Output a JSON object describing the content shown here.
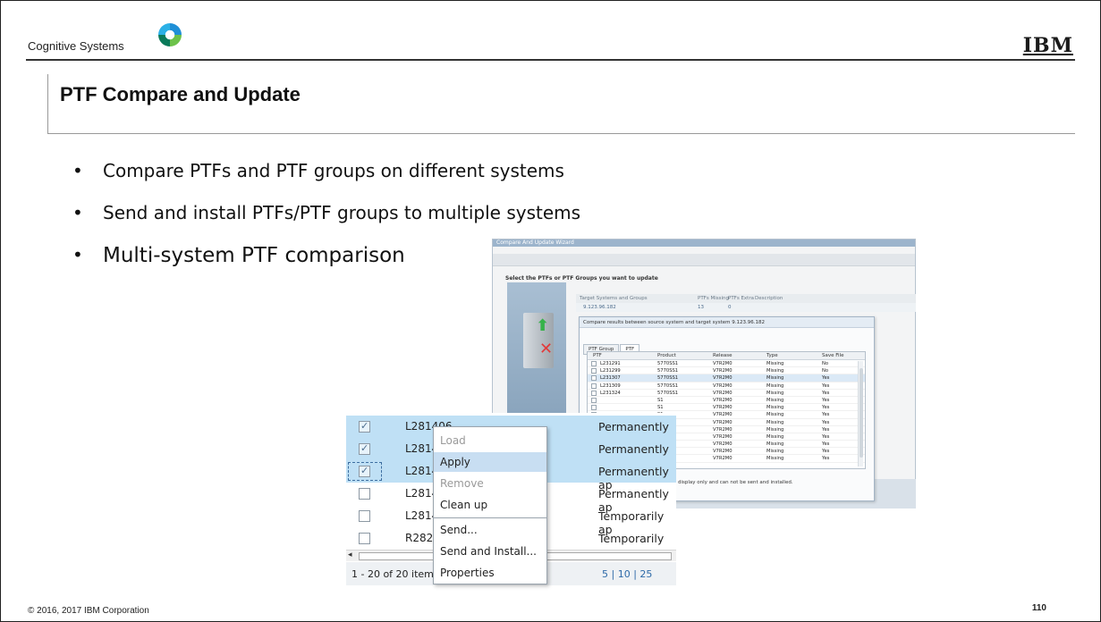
{
  "header": {
    "brand_text": "Cognitive Systems",
    "logo_text": "IBM"
  },
  "slide": {
    "title": "PTF Compare and Update",
    "bullets": [
      "Compare PTFs and PTF groups on different systems",
      "Send and install PTFs/PTF groups to multiple systems",
      "Multi-system PTF comparison"
    ]
  },
  "wizard": {
    "window_title": "Compare And Update Wizard",
    "heading": "Select the PTFs or PTF Groups you want to update",
    "target_columns": [
      "Target Systems and Groups",
      "PTFs Missing",
      "PTFs Extra",
      "Description"
    ],
    "target_row": {
      "system": "9.123.96.182",
      "missing": "13",
      "extra": "0"
    }
  },
  "compare_dialog": {
    "title": "Compare results between source system and target system 9.123.96.182",
    "tabs": [
      "PTF Group",
      "PTF"
    ],
    "columns": [
      "PTF",
      "Product",
      "Release",
      "Type",
      "Save File"
    ],
    "rows": [
      {
        "ptf": "L231291",
        "product": "5770SS1",
        "release": "V7R2M0",
        "type": "Missing",
        "save": "No"
      },
      {
        "ptf": "L231299",
        "product": "5770SS1",
        "release": "V7R2M0",
        "type": "Missing",
        "save": "No"
      },
      {
        "ptf": "L231307",
        "product": "5770SS1",
        "release": "V7R2M0",
        "type": "Missing",
        "save": "Yes"
      },
      {
        "ptf": "L231309",
        "product": "5770SS1",
        "release": "V7R2M0",
        "type": "Missing",
        "save": "Yes"
      },
      {
        "ptf": "L231324",
        "product": "5770SS1",
        "release": "V7R2M0",
        "type": "Missing",
        "save": "Yes"
      },
      {
        "ptf": "",
        "product": "S1",
        "release": "V7R2M0",
        "type": "Missing",
        "save": "Yes"
      },
      {
        "ptf": "",
        "product": "S1",
        "release": "V7R2M0",
        "type": "Missing",
        "save": "Yes"
      },
      {
        "ptf": "",
        "product": "S1",
        "release": "V7R2M0",
        "type": "Missing",
        "save": "Yes"
      },
      {
        "ptf": "",
        "product": "S1",
        "release": "V7R2M0",
        "type": "Missing",
        "save": "Yes"
      },
      {
        "ptf": "",
        "product": "S1",
        "release": "V7R2M0",
        "type": "Missing",
        "save": "Yes"
      },
      {
        "ptf": "",
        "product": "S1",
        "release": "V7R2M0",
        "type": "Missing",
        "save": "Yes"
      },
      {
        "ptf": "",
        "product": "S1",
        "release": "V7R2M0",
        "type": "Missing",
        "save": "Yes"
      },
      {
        "ptf": "",
        "product": "S1",
        "release": "V7R2M0",
        "type": "Missing",
        "save": "Yes"
      },
      {
        "ptf": "",
        "product": "",
        "release": "V7R2M0",
        "type": "Missing",
        "save": "Yes"
      }
    ],
    "note": "display only and can not be sent and installed."
  },
  "ptf_list": {
    "rows": [
      {
        "id": "L281406",
        "status": "Permanently ap",
        "checked": true
      },
      {
        "id": "L281428",
        "status": "Permanently ap",
        "checked": true
      },
      {
        "id": "L281434",
        "status": "Permanently ap",
        "checked": true
      },
      {
        "id": "L281440",
        "status": "Permanently ap",
        "checked": false
      },
      {
        "id": "L281460",
        "status": "Temporarily ap",
        "checked": false
      },
      {
        "id": "R28280",
        "status": "Temporarily ap",
        "checked": false
      }
    ],
    "pager_count": "1 - 20 of 20 items",
    "pager_sizes": "5  |  10  |  25"
  },
  "context_menu": {
    "items": [
      {
        "label": "Load",
        "state": "disabled"
      },
      {
        "label": "Apply",
        "state": "hover"
      },
      {
        "label": "Remove",
        "state": "disabled"
      },
      {
        "label": "Clean up",
        "state": "enabled"
      },
      {
        "label": "Send...",
        "state": "enabled"
      },
      {
        "label": "Send and Install...",
        "state": "enabled"
      },
      {
        "label": "Properties",
        "state": "enabled"
      }
    ]
  },
  "footer": {
    "copyright": "© 2016, 2017 IBM Corporation",
    "page_number": "110"
  }
}
